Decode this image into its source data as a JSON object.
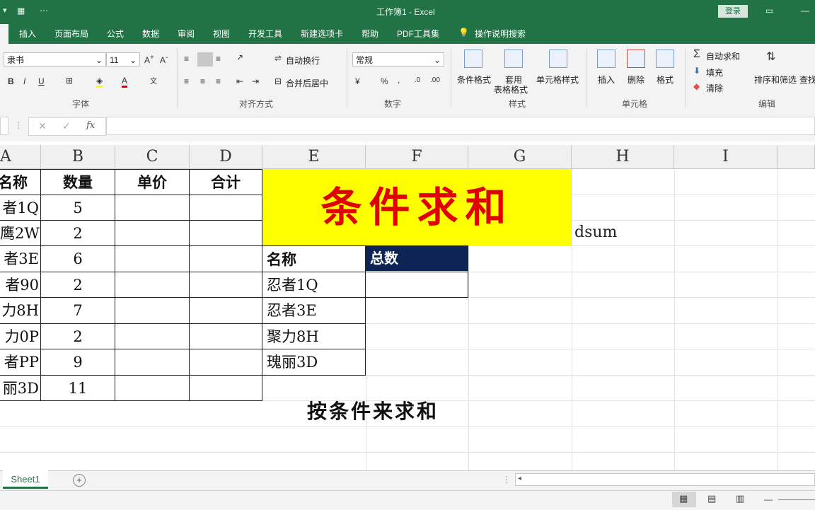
{
  "window": {
    "doc_title": "工作簿1 - Excel",
    "login_label": "登录"
  },
  "tabs": [
    "插入",
    "页面布局",
    "公式",
    "数据",
    "审阅",
    "视图",
    "开发工具",
    "新建选项卡",
    "帮助",
    "PDF工具集",
    "操作说明搜索"
  ],
  "ribbon": {
    "font_name": "隶书",
    "font_size": "11",
    "bold": "B",
    "italic": "I",
    "underline": "U",
    "wrap_text": "自动换行",
    "merge_center": "合并后居中",
    "number_format": "常规",
    "percent": "%",
    "comma": ",",
    "cond_format": "条件格式",
    "table_format_1": "套用",
    "table_format_2": "表格格式",
    "cell_styles": "单元格样式",
    "insert": "插入",
    "delete": "删除",
    "format": "格式",
    "autosum": "自动求和",
    "fill": "填充",
    "clear": "清除",
    "sort_filter": "排序和筛选",
    "find": "查找",
    "groups": {
      "font": "字体",
      "alignment": "对齐方式",
      "number": "数字",
      "styles": "样式",
      "cells": "单元格",
      "editing": "编辑"
    }
  },
  "formula_bar": {
    "fx": "fx",
    "value": ""
  },
  "columns": [
    "A",
    "B",
    "C",
    "D",
    "E",
    "F",
    "G",
    "H",
    "I"
  ],
  "table": {
    "headers": [
      "名称",
      "数量",
      "单价",
      "合计"
    ],
    "rows": [
      [
        "者1Q",
        "5"
      ],
      [
        "鹰2W",
        "2"
      ],
      [
        "者3E",
        "6"
      ],
      [
        "者90",
        "2"
      ],
      [
        "力8H",
        "7"
      ],
      [
        "力0P",
        "2"
      ],
      [
        "者PP",
        "9"
      ],
      [
        "丽3D",
        "11"
      ]
    ]
  },
  "banner_text": "条件求和",
  "dsum_note": "dsum",
  "criteria": {
    "name_header": "名称",
    "total_header": "总数",
    "names": [
      "忍者1Q",
      "忍者3E",
      "聚力8H",
      "瑰丽3D"
    ]
  },
  "subtitle": "按条件来求和",
  "sheet_tab": "Sheet1",
  "colors": {
    "excel_green": "#217346",
    "banner_bg": "#ffff00",
    "banner_text": "#e00000",
    "total_header_bg": "#0d2455"
  }
}
